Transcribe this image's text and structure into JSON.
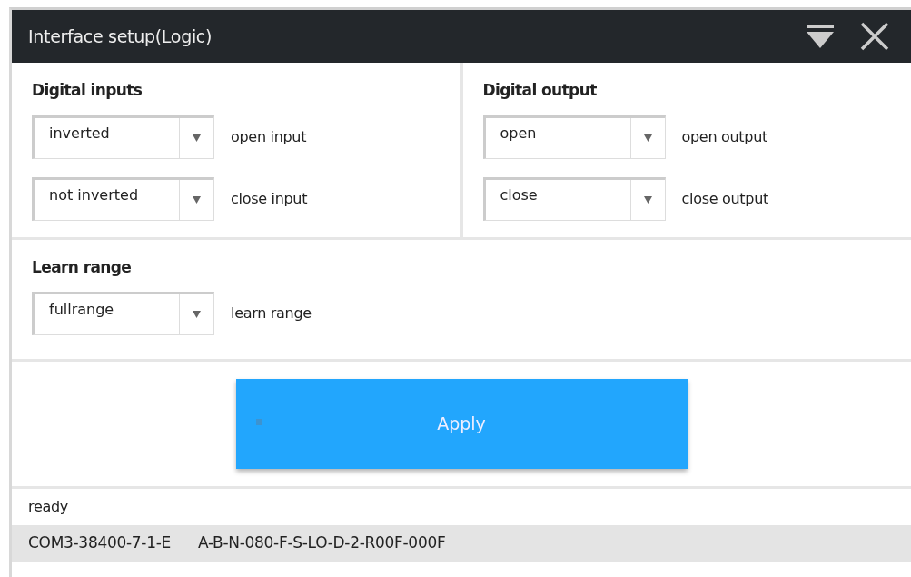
{
  "window": {
    "title": "Interface setup(Logic)"
  },
  "groups": [
    {
      "title": "Digital inputs",
      "rows": [
        {
          "value": "inverted",
          "label": "open input"
        },
        {
          "value": "not inverted",
          "label": "close input"
        }
      ]
    },
    {
      "title": "Digital output",
      "rows": [
        {
          "value": "open",
          "label": "open output"
        },
        {
          "value": "close",
          "label": "close output"
        }
      ]
    },
    {
      "title": "Learn range",
      "rows": [
        {
          "value": "fullrange",
          "label": "learn range"
        }
      ]
    }
  ],
  "apply_button": {
    "label": "Apply"
  },
  "status": "ready",
  "status_bar": {
    "port": "COM3-38400-7-1-E",
    "config": "A-B-N-080-F-S-LO-D-2-R00F-000F"
  }
}
